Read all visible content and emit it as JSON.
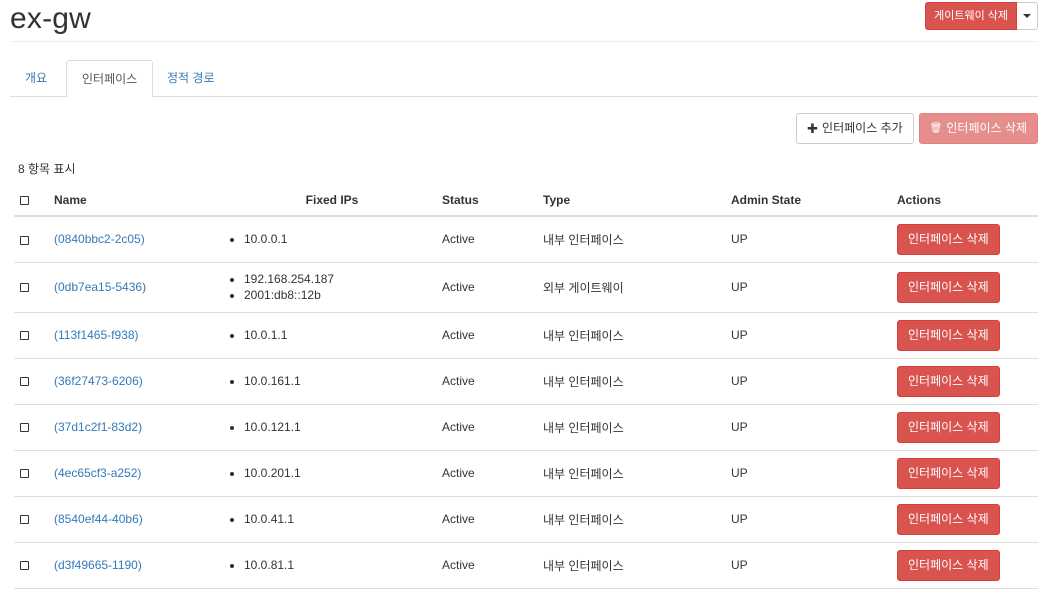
{
  "header": {
    "title": "ex-gw",
    "delete_gateway_label": "게이트웨이 삭제"
  },
  "tabs": [
    {
      "label": "개요",
      "active": false
    },
    {
      "label": "인터페이스",
      "active": true
    },
    {
      "label": "정적 경로",
      "active": false
    }
  ],
  "toolbar": {
    "add_label": "인터페이스 추가",
    "delete_label": "인터페이스 삭제"
  },
  "item_count": "8 항목 표시",
  "table": {
    "columns": [
      "Name",
      "Fixed IPs",
      "Status",
      "Type",
      "Admin State",
      "Actions"
    ],
    "rows": [
      {
        "name": "(0840bbc2-2c05)",
        "ips": [
          "10.0.0.1"
        ],
        "status": "Active",
        "type": "내부 인터페이스",
        "admin_state": "UP",
        "action": "인터페이스 삭제"
      },
      {
        "name": "(0db7ea15-5436)",
        "ips": [
          "192.168.254.187",
          "2001:db8::12b"
        ],
        "status": "Active",
        "type": "외부 게이트웨이",
        "admin_state": "UP",
        "action": "인터페이스 삭제"
      },
      {
        "name": "(113f1465-f938)",
        "ips": [
          "10.0.1.1"
        ],
        "status": "Active",
        "type": "내부 인터페이스",
        "admin_state": "UP",
        "action": "인터페이스 삭제"
      },
      {
        "name": "(36f27473-6206)",
        "ips": [
          "10.0.161.1"
        ],
        "status": "Active",
        "type": "내부 인터페이스",
        "admin_state": "UP",
        "action": "인터페이스 삭제"
      },
      {
        "name": "(37d1c2f1-83d2)",
        "ips": [
          "10.0.121.1"
        ],
        "status": "Active",
        "type": "내부 인터페이스",
        "admin_state": "UP",
        "action": "인터페이스 삭제"
      },
      {
        "name": "(4ec65cf3-a252)",
        "ips": [
          "10.0.201.1"
        ],
        "status": "Active",
        "type": "내부 인터페이스",
        "admin_state": "UP",
        "action": "인터페이스 삭제"
      },
      {
        "name": "(8540ef44-40b6)",
        "ips": [
          "10.0.41.1"
        ],
        "status": "Active",
        "type": "내부 인터페이스",
        "admin_state": "UP",
        "action": "인터페이스 삭제"
      },
      {
        "name": "(d3f49665-1190)",
        "ips": [
          "10.0.81.1"
        ],
        "status": "Active",
        "type": "내부 인터페이스",
        "admin_state": "UP",
        "action": "인터페이스 삭제"
      }
    ]
  }
}
